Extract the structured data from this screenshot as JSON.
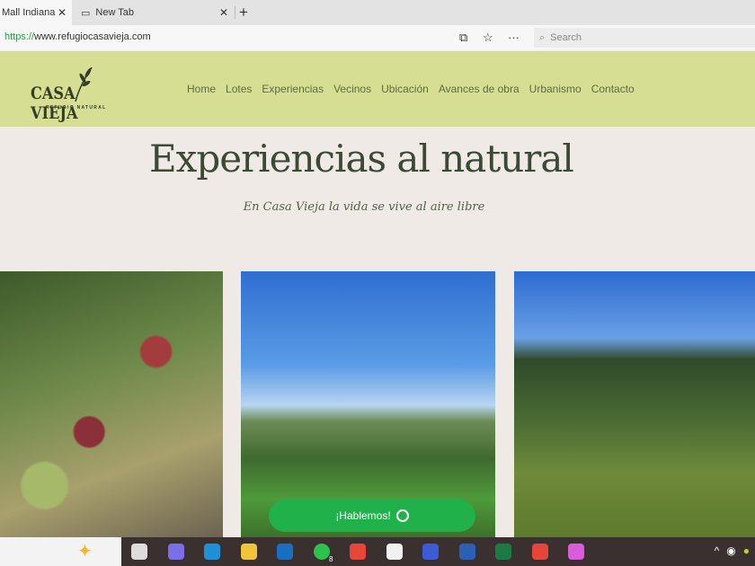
{
  "browser": {
    "tabs": [
      {
        "label": "Mall Indiana"
      },
      {
        "label": "New Tab"
      }
    ],
    "url_scheme": "https://",
    "url_rest": "www.refugiocasavieja.com",
    "search_placeholder": "Search"
  },
  "site": {
    "logo": "CASA VIEJA",
    "logo_sub": "REFUGIO NATURAL",
    "nav": [
      "Home",
      "Lotes",
      "Experiencias",
      "Vecinos",
      "Ubicación",
      "Avances de obra",
      "Urbanismo",
      "Contacto"
    ],
    "title": "Experiencias al natural",
    "tagline": "En Casa Vieja la vida se vive al aire libre",
    "cta": "¡Hablemos!"
  },
  "taskbar": {
    "apps": [
      "task-view",
      "copilot",
      "edge",
      "file-explorer",
      "outlook",
      "whatsapp",
      "chrome",
      "store",
      "azure-data",
      "word",
      "excel",
      "wps",
      "paint"
    ],
    "whatsapp_badge": "8",
    "colors": [
      "#ddd",
      "#7b6ee6",
      "#1f8fd6",
      "#f0c53a",
      "#1a6fc2",
      "#2cc14c",
      "#e9463a",
      "#f1f1f1",
      "#3b5bd8",
      "#2b5fb8",
      "#1d7a45",
      "#e6453a",
      "#d95cdb"
    ]
  }
}
